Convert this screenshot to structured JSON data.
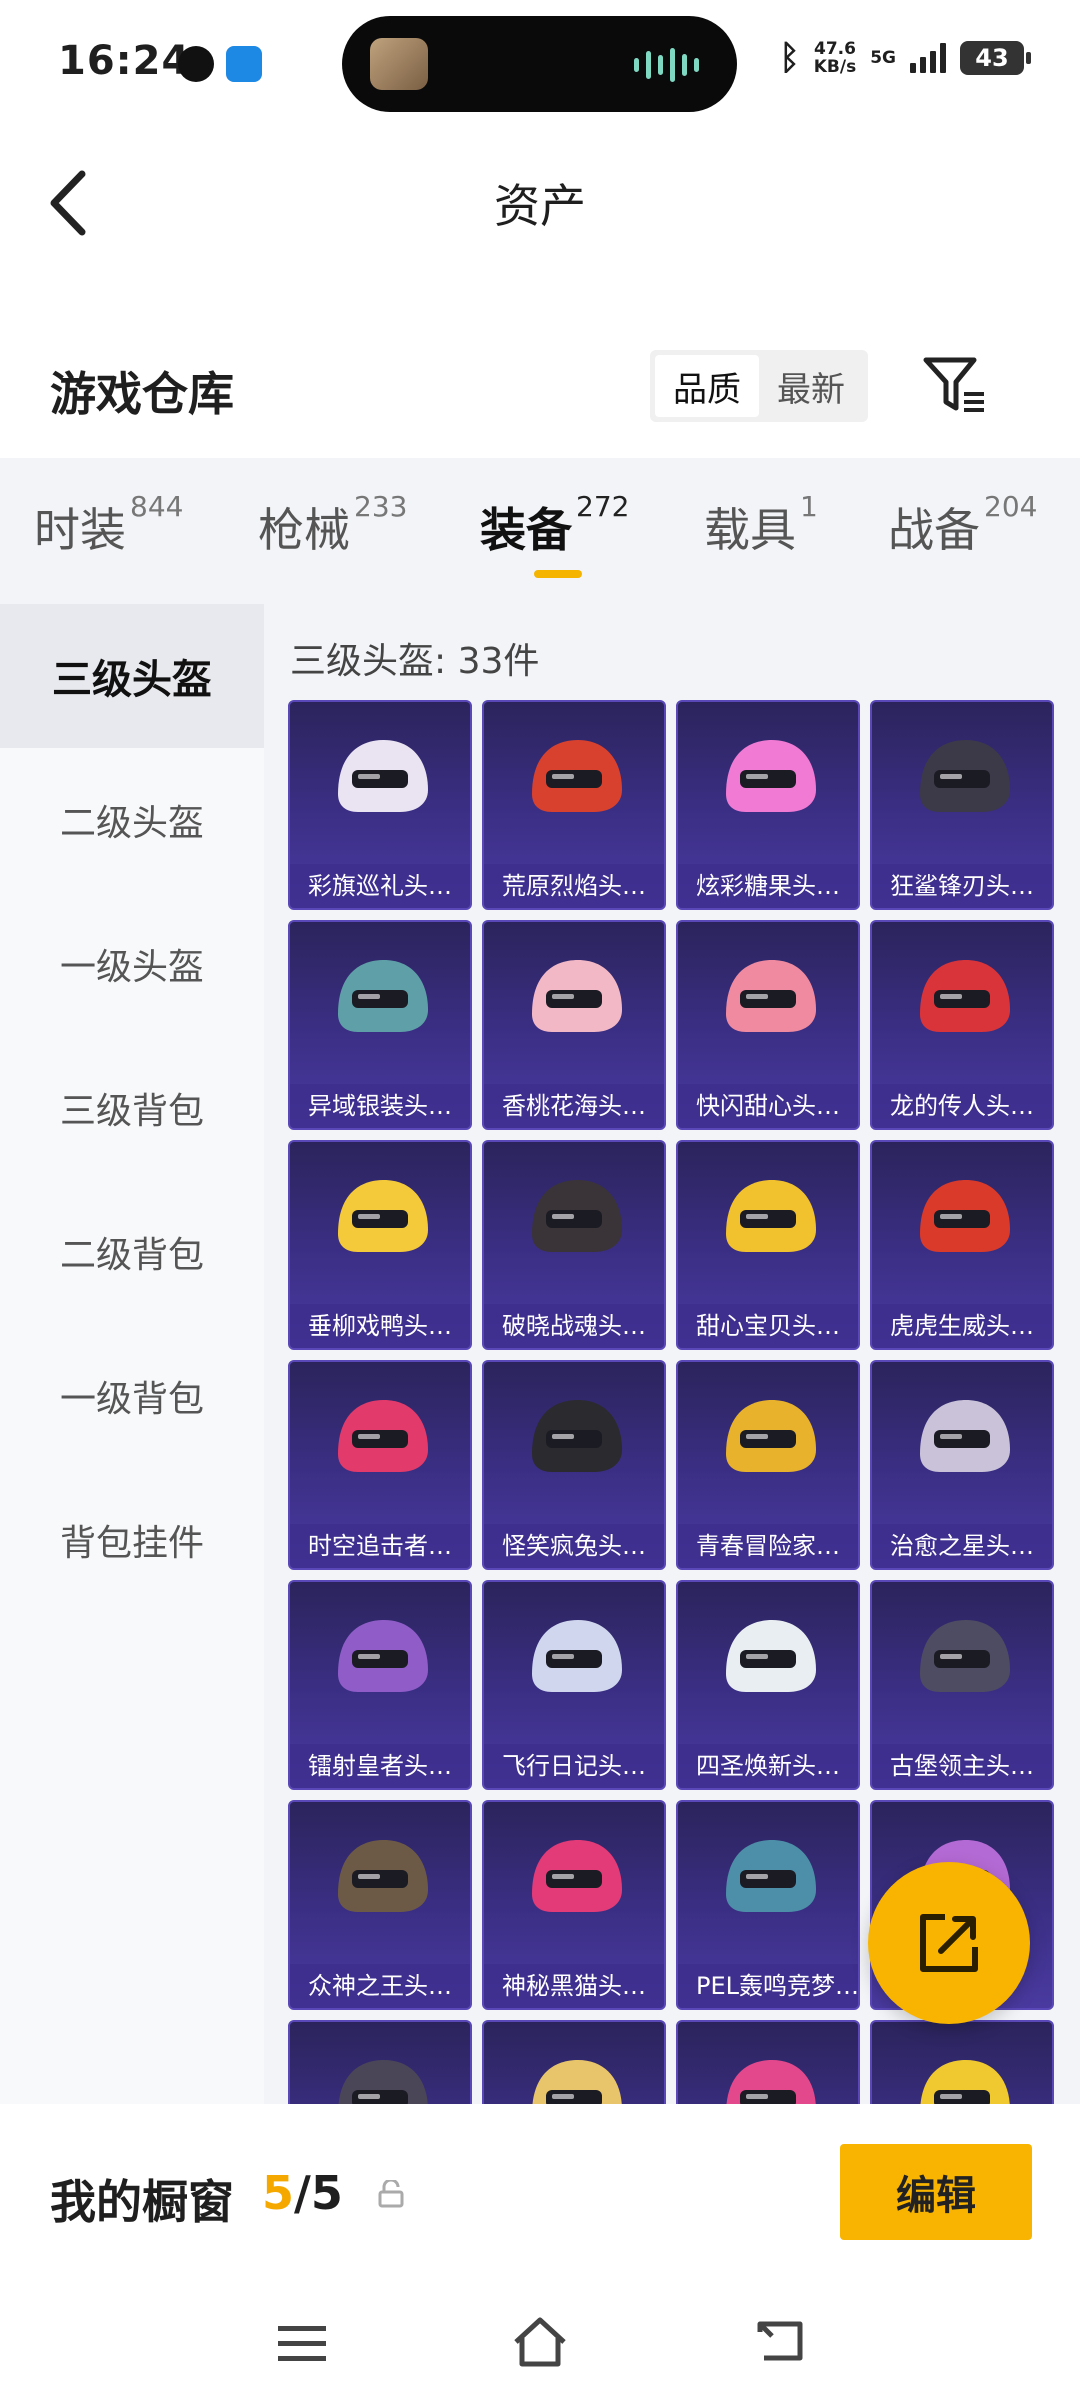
{
  "status_bar": {
    "time": "16:24",
    "net_speed": "47.6",
    "net_unit": "KB/s",
    "network": "5G",
    "battery": "43"
  },
  "header": {
    "title": "资产"
  },
  "warehouse": {
    "title": "游戏仓库",
    "sort_options": [
      "品质",
      "最新"
    ],
    "selected_sort": "品质"
  },
  "tabs": [
    {
      "label": "时装",
      "count": "844"
    },
    {
      "label": "枪械",
      "count": "233"
    },
    {
      "label": "装备",
      "count": "272"
    },
    {
      "label": "载具",
      "count": "1"
    },
    {
      "label": "战备",
      "count": "204"
    }
  ],
  "active_tab": "装备",
  "sidebar": {
    "items": [
      "三级头盔",
      "二级头盔",
      "一级头盔",
      "三级背包",
      "二级背包",
      "一级背包",
      "背包挂件"
    ],
    "active": "三级头盔"
  },
  "grid": {
    "count_label": "三级头盔: 33件",
    "items": [
      {
        "name": "彩旗巡礼头…",
        "color": "#e9e3f2"
      },
      {
        "name": "荒原烈焰头…",
        "color": "#d8412e"
      },
      {
        "name": "炫彩糖果头…",
        "color": "#f07ad4"
      },
      {
        "name": "狂鲨锋刃头…",
        "color": "#3c3a48"
      },
      {
        "name": "异域银装头…",
        "color": "#5fa0a8"
      },
      {
        "name": "香桃花海头…",
        "color": "#f3b8c6"
      },
      {
        "name": "快闪甜心头…",
        "color": "#f08aa0"
      },
      {
        "name": "龙的传人头…",
        "color": "#d9343a"
      },
      {
        "name": "垂柳戏鸭头…",
        "color": "#f4c93a"
      },
      {
        "name": "破晓战魂头…",
        "color": "#3a3438"
      },
      {
        "name": "甜心宝贝头…",
        "color": "#f2c12e"
      },
      {
        "name": "虎虎生威头…",
        "color": "#d93a2a"
      },
      {
        "name": "时空追击者…",
        "color": "#e23a6a"
      },
      {
        "name": "怪笑疯兔头…",
        "color": "#2b2a2e"
      },
      {
        "name": "青春冒险家…",
        "color": "#e8b22c"
      },
      {
        "name": "治愈之星头…",
        "color": "#c9c2d8"
      },
      {
        "name": "镭射皇者头…",
        "color": "#8f5cc8"
      },
      {
        "name": "飞行日记头…",
        "color": "#cfd6ee"
      },
      {
        "name": "四圣焕新头…",
        "color": "#e9eef2"
      },
      {
        "name": "古堡领主头…",
        "color": "#4e4c62"
      },
      {
        "name": "众神之王头…",
        "color": "#6d5a46"
      },
      {
        "name": "神秘黑猫头…",
        "color": "#e33a78"
      },
      {
        "name": "PEL轰鸣竞梦…",
        "color": "#4d8fa8"
      },
      {
        "name": "",
        "color": "#b46ad4"
      },
      {
        "name": "",
        "color": "#4a4658"
      },
      {
        "name": "",
        "color": "#e8c56a"
      },
      {
        "name": "",
        "color": "#e4488c"
      },
      {
        "name": "",
        "color": "#f0c830"
      }
    ]
  },
  "showcase": {
    "label": "我的橱窗",
    "current": "5",
    "total": "/5",
    "edit_label": "编辑"
  },
  "colors": {
    "accent": "#f8b400",
    "card_bg": "#3b2f86"
  }
}
